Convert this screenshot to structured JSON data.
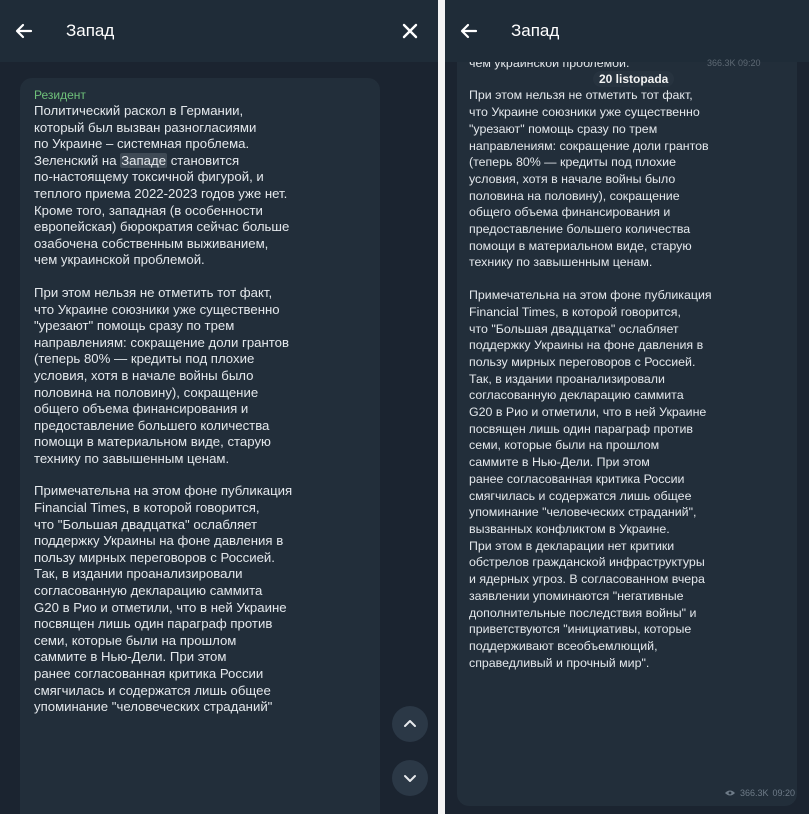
{
  "left_panel": {
    "title": "Запад",
    "sender": "Резидент",
    "highlight_before": "Зеленский на ",
    "highlight_word": "Западе",
    "paragraphs": [
      "Политический раскол в Германии,\nкоторый был вызван разногласиями\nпо Украине – системная проблема.",
      " становится\nпо-настоящему токсичной фигурой, и\nтеплого приема 2022-2023 годов уже нет.\nКроме того, западная (в особенности\nевропейская) бюрократия сейчас больше\nозабочена собственным выживанием,\nчем украинской проблемой.",
      "При этом нельзя не отметить тот факт,\nчто Украине союзники уже существенно\n\"урезают\" помощь сразу по трем\nнаправлениям: сокращение доли грантов\n(теперь 80% — кредиты под плохие\nусловия, хотя в начале войны было\nполовина на половину), сокращение\nобщего объема финансирования и\nпредоставление большего количества\nпомощи в материальном виде, старую\nтехнику по завышенным ценам.",
      "Примечательна на этом фоне публикация\nFinancial Times, в которой говорится,\nчто \"Большая двадцатка\" ослабляет\nподдержку Украины на фоне давления в\nпользу мирных переговоров с Россией.\nТак, в издании проанализировали\nсогласованную декларацию саммита\nG20 в Рио и отметили, что в ней Украине\nпосвящен лишь один параграф против\nсеми, которые были на прошлом\nсаммите в Нью-Дели. При этом\nранее согласованная критика России\nсмягчилась и содержатся лишь общее\nупоминание \"человеческих страданий\""
    ]
  },
  "right_panel": {
    "title": "Запад",
    "date_pill": "20 listopada",
    "prev_meta": "366.3K 09:20",
    "paragraphs": [
      "озабочена собственным выживанием,\nчем украинской проблемой.",
      "При этом нельзя не отметить тот факт,\nчто Украине союзники уже существенно\n\"урезают\" помощь сразу по трем\nнаправлениям: сокращение доли грантов\n(теперь 80% — кредиты под плохие\nусловия, хотя в начале войны было\nполовина на половину), сокращение\nобщего объема финансирования и\nпредоставление большего количества\nпомощи в материальном виде, старую\nтехнику по завышенным ценам.",
      "Примечательна на этом фоне публикация\nFinancial Times, в которой говорится,\nчто \"Большая двадцатка\" ослабляет\nподдержку Украины на фоне давления в\nпользу мирных переговоров с Россией.\nТак, в издании проанализировали\nсогласованную декларацию саммита\nG20 в Рио и отметили, что в ней Украине\nпосвящен лишь один параграф против\nсеми, которые были на прошлом\nсаммите в Нью-Дели. При этом\nранее согласованная критика России\nсмягчилась и содержатся лишь общее\nупоминание \"человеческих страданий\",\nвызванных конфликтом в Украине.\nПри этом в декларации нет критики\nобстрелов гражданской инфраструктуры\nи ядерных угроз. В согласованном вчера\nзаявлении упоминаются \"негативные\nдополнительные последствия войны\" и\nприветствуются \"инициативы, которые\nподдерживают всеобъемлющий,\nсправедливый и прочный мир\"."
    ],
    "views": "366.3K",
    "time": "09:20"
  },
  "icons": {
    "back": "arrow-left-icon",
    "close": "close-icon",
    "scroll_up": "chevron-up-icon",
    "scroll_down": "chevron-down-icon",
    "views": "eye-icon"
  },
  "colors": {
    "background": "#17212b",
    "header": "#1f2c38",
    "bubble": "#222e3a",
    "sender": "#6fc07a",
    "text": "#e4e8ec"
  }
}
